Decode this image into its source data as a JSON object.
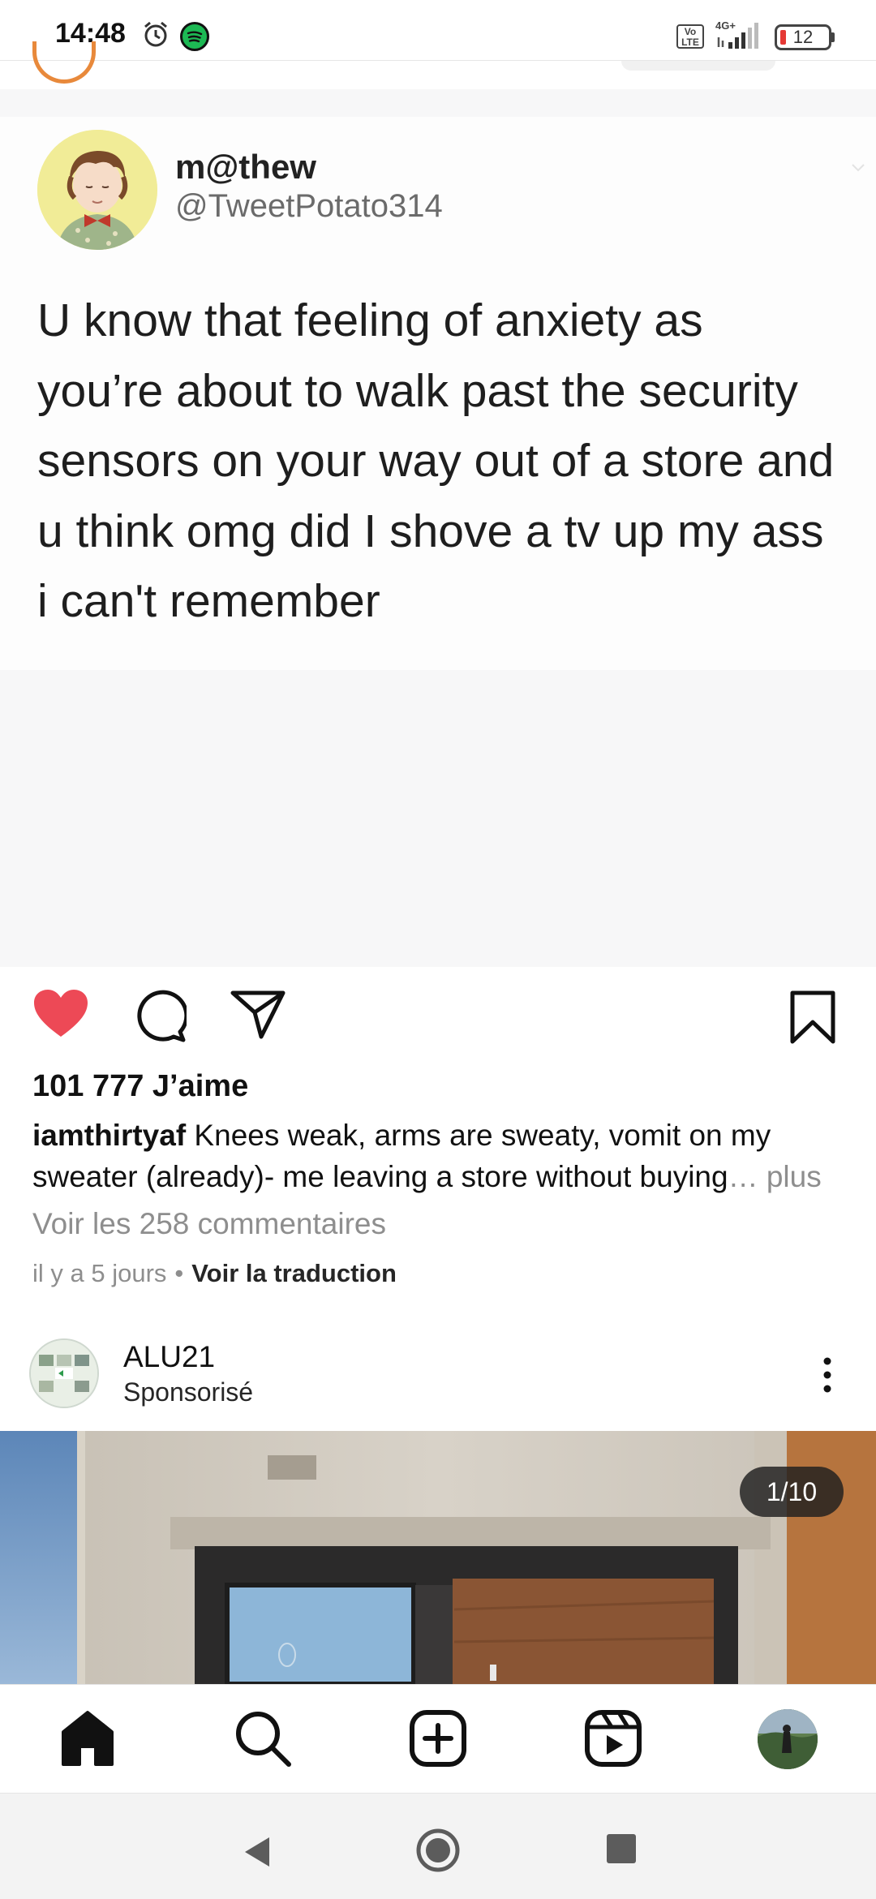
{
  "status_bar": {
    "time": "14:48",
    "network": "4G+",
    "volte": "Vo LTE",
    "battery": "12",
    "battery_level": 0.12,
    "battery_color": "#e53935"
  },
  "post": {
    "tweet": {
      "name": "m@thew",
      "handle": "@TweetPotato314",
      "text": "U know that feeling of anxiety as\nyou’re about to walk past the security\nsensors on your way out of a store and\nu think omg did I shove a tv up my ass\ni can't remember"
    },
    "likes": "101 777 J’aime",
    "caption_user": "iamthirtyaf",
    "caption_text": " Knees weak, arms are sweaty, vomit on my sweater (already)- me leaving a store without buying",
    "caption_more": "… plus",
    "view_comments": "Voir les 258 commentaires",
    "time_ago": "il y a 5 jours",
    "translate": "Voir la traduction",
    "liked": true,
    "like_color": "#ed4956"
  },
  "sponsored": {
    "name": "ALU21",
    "label": "Sponsorisé",
    "counter": "1/10"
  },
  "icons": {
    "like": "heart-filled-icon",
    "comment": "comment-bubble-icon",
    "share": "paper-plane-icon",
    "save": "bookmark-icon",
    "home": "home-icon",
    "search": "search-icon",
    "create": "plus-square-icon",
    "reels": "reels-icon"
  }
}
